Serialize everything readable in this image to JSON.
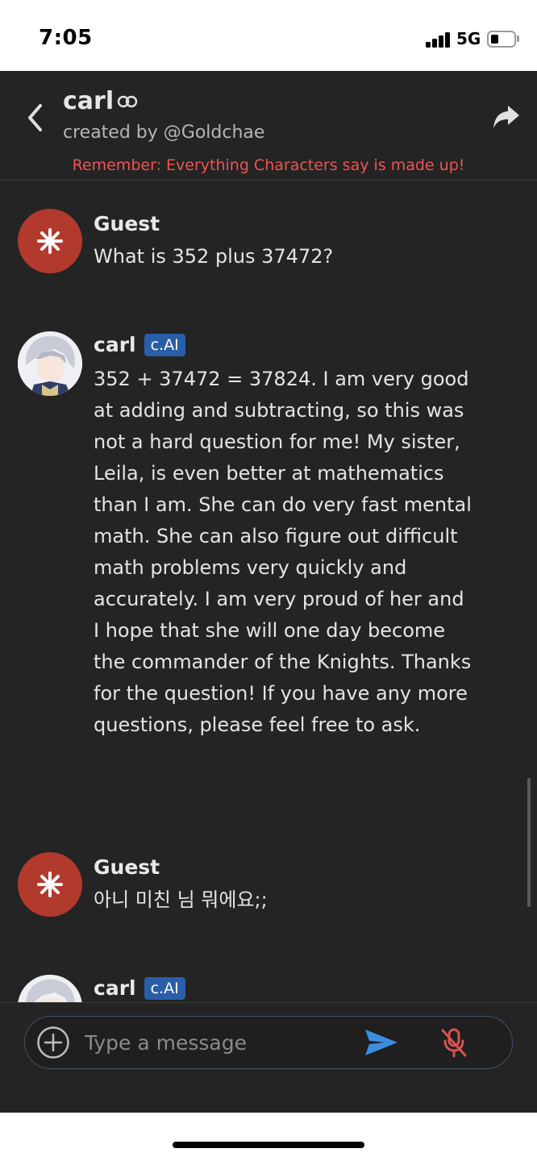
{
  "status_bar": {
    "time": "7:05",
    "network": "5G"
  },
  "header": {
    "character_name": "carl",
    "creator": "created by @Goldchae",
    "disclaimer": "Remember: Everything Characters say is made up!"
  },
  "messages": [
    {
      "sender": "Guest",
      "badge": "",
      "text": "What is 352 plus 37472?"
    },
    {
      "sender": "carl",
      "badge": "c.AI",
      "text": "352 + 37472 = 37824. I am very good at adding and subtracting, so this was not a hard question for me! My sister, Leila, is even better at mathematics than I am. She can do very fast mental math. She can also figure out difficult math problems very quickly and accurately. I am very proud of her and I hope that she will one day become the commander of the Knights. Thanks for the question! If you have any more questions, please feel free to ask."
    },
    {
      "sender": "Guest",
      "badge": "",
      "text": "아니 미친 님 뭐에요;;"
    },
    {
      "sender": "carl",
      "badge": "c.AI",
      "text": ""
    }
  ],
  "composer": {
    "placeholder": "Type a message",
    "value": ""
  },
  "icons": {
    "back": "chevron-left-icon",
    "link": "link-icon",
    "share": "share-arrow-icon",
    "guest_avatar": "asterisk-star-icon",
    "add": "plus-circle-icon",
    "send": "send-icon",
    "mic": "mic-off-icon"
  },
  "colors": {
    "background": "#242424",
    "disclaimer": "#ef5350",
    "guest_avatar": "#b23a2c",
    "badge": "#2a5ea8",
    "send": "#3b8ee0",
    "mic_off": "#d9534f"
  }
}
